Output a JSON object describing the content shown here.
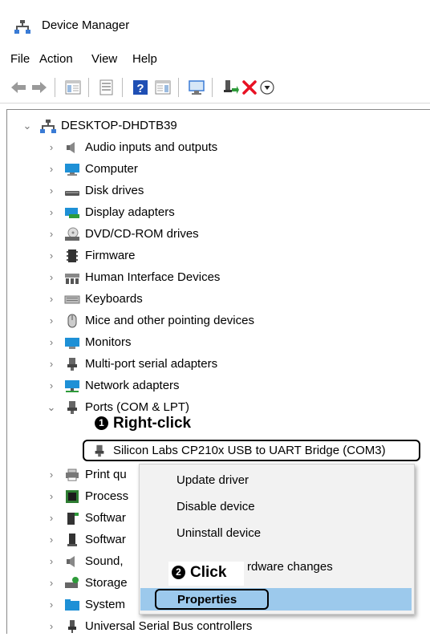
{
  "window": {
    "title": "Device Manager"
  },
  "menu": [
    "File",
    "Action",
    "View",
    "Help"
  ],
  "tree": {
    "root": "DESKTOP-DHDTB39",
    "items": [
      {
        "label": "Audio inputs and outputs",
        "icon": "speaker-icon"
      },
      {
        "label": "Computer",
        "icon": "monitor-icon"
      },
      {
        "label": "Disk drives",
        "icon": "disk-drive-icon"
      },
      {
        "label": "Display adapters",
        "icon": "display-adapter-icon"
      },
      {
        "label": "DVD/CD-ROM drives",
        "icon": "dvd-drive-icon"
      },
      {
        "label": "Firmware",
        "icon": "chip-icon"
      },
      {
        "label": "Human Interface Devices",
        "icon": "hid-icon"
      },
      {
        "label": "Keyboards",
        "icon": "keyboard-icon"
      },
      {
        "label": "Mice and other pointing devices",
        "icon": "mouse-icon"
      },
      {
        "label": "Monitors",
        "icon": "monitor-icon"
      },
      {
        "label": "Multi-port serial adapters",
        "icon": "port-icon"
      },
      {
        "label": "Network adapters",
        "icon": "network-icon"
      },
      {
        "label": "Ports (COM & LPT)",
        "icon": "port-icon"
      }
    ],
    "selected_child": "Silicon Labs CP210x USB to UART Bridge (COM3)",
    "after_items": [
      {
        "label": "Print qu",
        "icon": "printer-icon"
      },
      {
        "label": "Process",
        "icon": "processor-icon"
      },
      {
        "label": "Softwar",
        "icon": "software-component-icon"
      },
      {
        "label": "Softwar",
        "icon": "software-device-icon"
      },
      {
        "label": "Sound,",
        "icon": "speaker-icon"
      },
      {
        "label": "Storage",
        "icon": "storage-icon"
      },
      {
        "label": "System",
        "icon": "folder-icon"
      },
      {
        "label": "Universal Serial Bus controllers",
        "icon": "usb-icon"
      }
    ]
  },
  "context_menu": {
    "items": [
      "Update driver",
      "Disable device",
      "Uninstall device",
      "rdware changes",
      "Properties"
    ]
  },
  "annotations": {
    "step1_num": "1",
    "step1_text": "Right-click",
    "step2_num": "2",
    "step2_text": "Click"
  },
  "colors": {
    "highlight": "#9cc9ec",
    "delete_red": "#e81123",
    "monitor_blue": "#1e90d6"
  }
}
